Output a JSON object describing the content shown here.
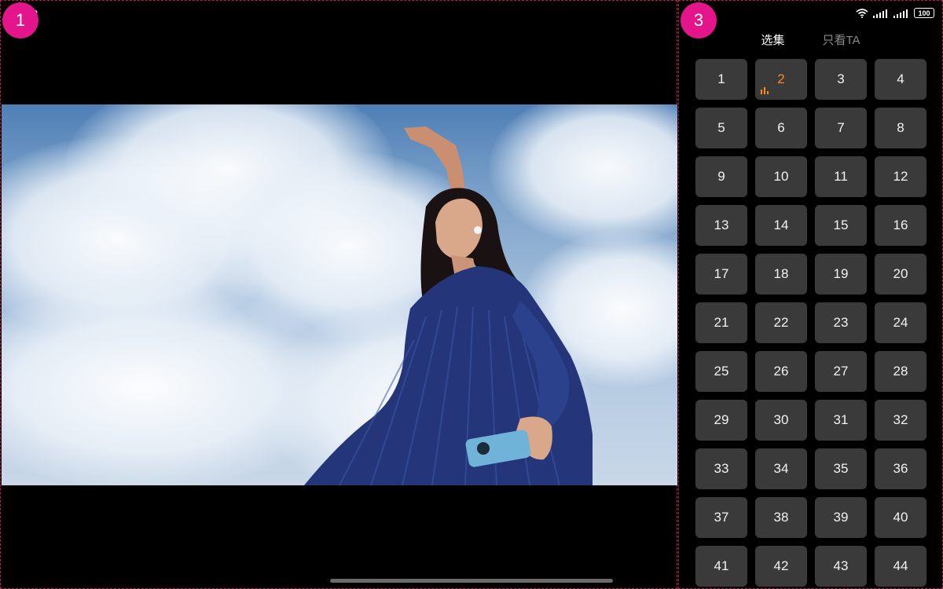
{
  "status": {
    "time_fragment": "3",
    "battery": "100",
    "wifi_icon": "wifi-icon",
    "signal_icon": "signal-bars-icon"
  },
  "panes": {
    "left_badge": "1",
    "right_badge": "3"
  },
  "tabs": [
    {
      "label": "选集",
      "active": true
    },
    {
      "label": "只看TA",
      "active": false
    }
  ],
  "episodes": {
    "current": 2,
    "accent_color": "#ff8a1f",
    "items": [
      "1",
      "2",
      "3",
      "4",
      "5",
      "6",
      "7",
      "8",
      "9",
      "10",
      "11",
      "12",
      "13",
      "14",
      "15",
      "16",
      "17",
      "18",
      "19",
      "20",
      "21",
      "22",
      "23",
      "24",
      "25",
      "26",
      "27",
      "28",
      "29",
      "30",
      "31",
      "32",
      "33",
      "34",
      "35",
      "36",
      "37",
      "38",
      "39",
      "40",
      "41",
      "42",
      "43",
      "44"
    ]
  }
}
